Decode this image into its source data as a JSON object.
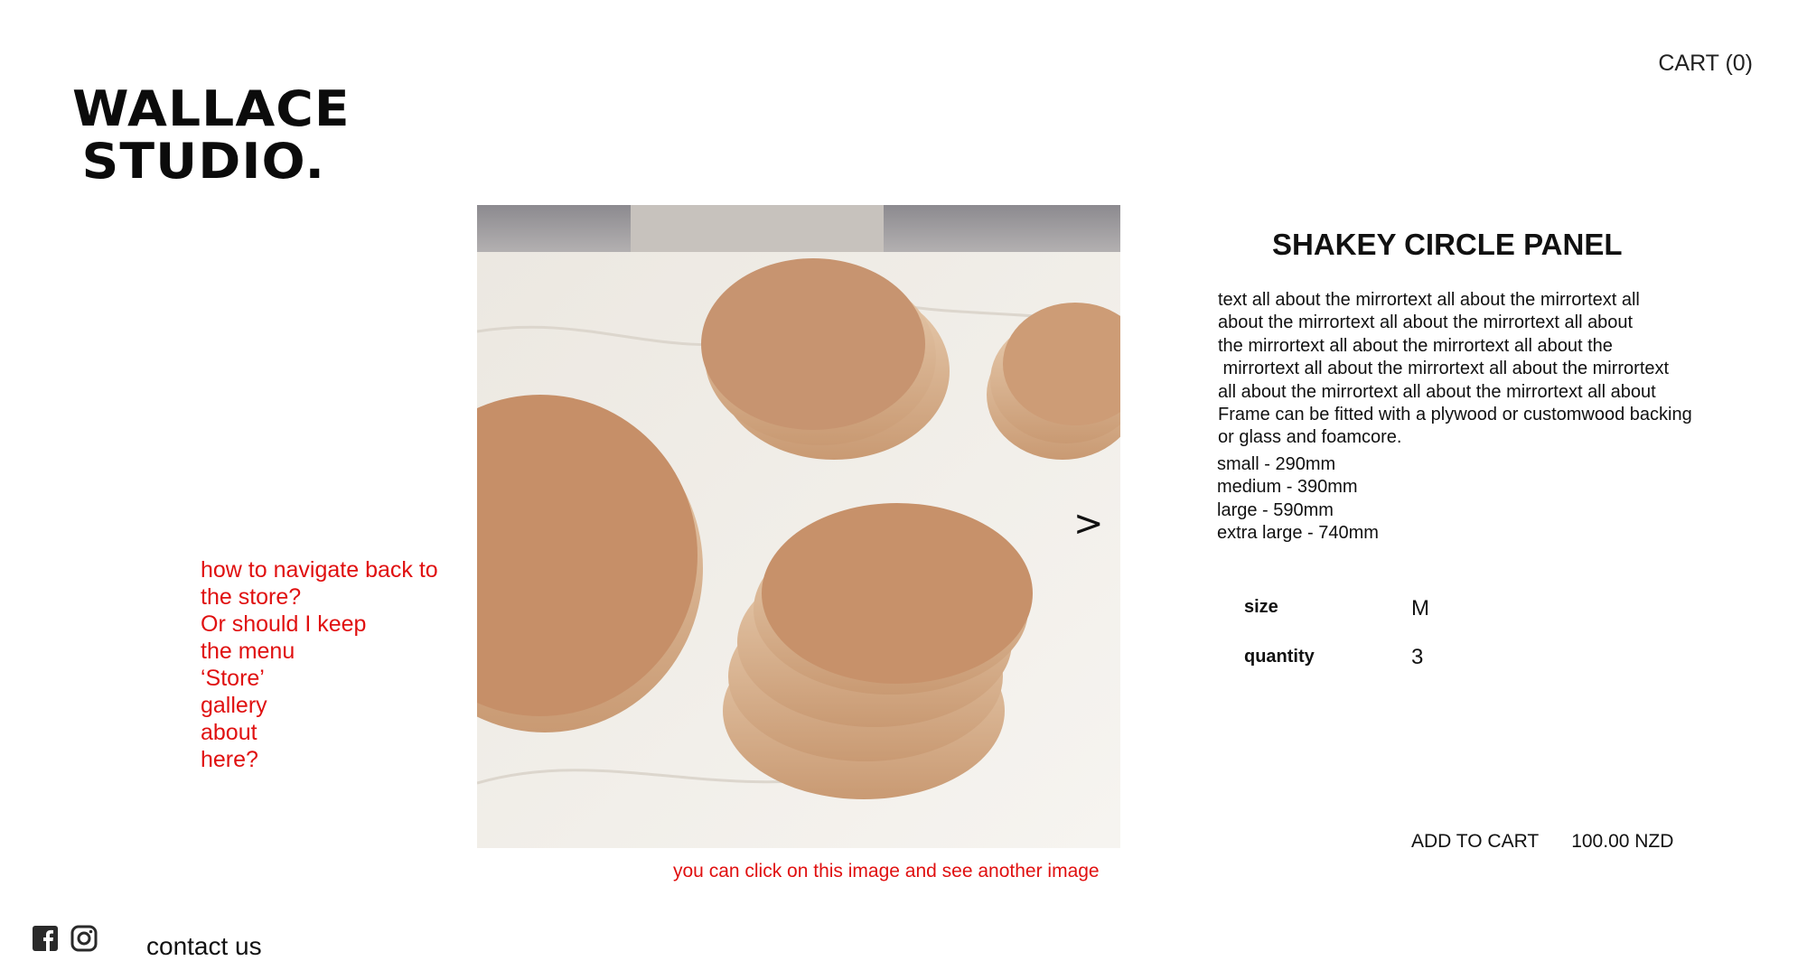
{
  "brand": {
    "line1": "WALLACE",
    "line2": "STUDIO."
  },
  "header": {
    "cart_label": "CART (0)"
  },
  "annotation": {
    "lines": [
      "how to navigate back to",
      "the store?",
      "Or should I keep",
      "the menu",
      "‘Store’",
      "gallery",
      "about",
      "here?"
    ]
  },
  "gallery": {
    "next_glyph": ">",
    "caption": "you can click on this image and see another image"
  },
  "product": {
    "title": "SHAKEY CIRCLE PANEL",
    "description_lines": [
      "text all about the mirrortext all about the mirrortext all",
      "about the mirrortext all about the mirrortext all about",
      "the mirrortext all about the mirrortext all about the",
      " mirrortext all about the mirrortext all about the mirrortext",
      "all about the mirrortext all about the mirrortext all about",
      "Frame can be fitted with a plywood or customwood backing",
      "or glass and foamcore."
    ],
    "sizes": [
      "small - 290mm",
      "medium - 390mm",
      "large - 590mm",
      "extra large - 740mm"
    ],
    "options": {
      "size_label": "size",
      "size_value": "M",
      "quantity_label": "quantity",
      "quantity_value": "3"
    },
    "add_to_cart_label": "ADD TO CART",
    "price": "100.00 NZD"
  },
  "footer": {
    "contact_label": "contact us",
    "icons": [
      "facebook-icon",
      "instagram-icon"
    ]
  },
  "colors": {
    "accent_red": "#e01010",
    "text": "#111111",
    "panel_tan": "#c69168"
  }
}
